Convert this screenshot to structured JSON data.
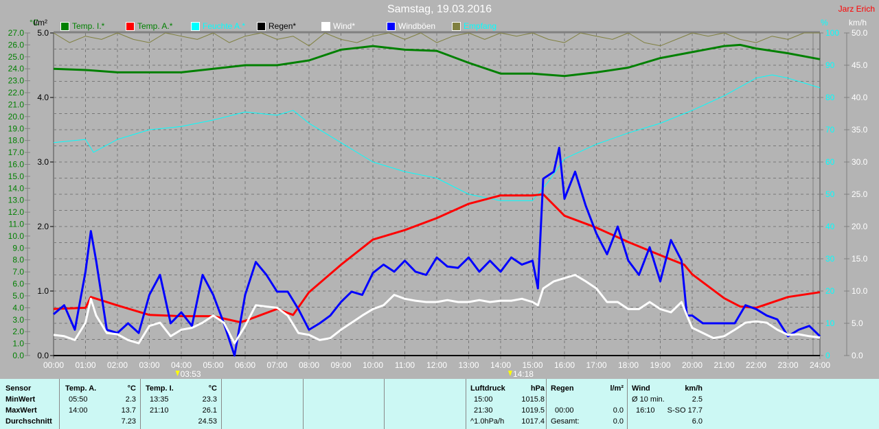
{
  "title": "Samstag, 19.03.2016",
  "author": "Jarz Erich",
  "legend": [
    {
      "label": "Temp. I.*",
      "color": "#008000",
      "text_color": "#008000"
    },
    {
      "label": "Temp. A.*",
      "color": "#ff0000",
      "text_color": "#008000"
    },
    {
      "label": "Feuchte A.*",
      "color": "#00ffff",
      "text_color": "#00ffff"
    },
    {
      "label": "Regen*",
      "color": "#000000",
      "text_color": "#000000"
    },
    {
      "label": "Wind*",
      "color": "#ffffff",
      "text_color": "#ffffff"
    },
    {
      "label": "Windböen",
      "color": "#0000ff",
      "text_color": "#ffffff"
    },
    {
      "label": "Empfang",
      "color": "#808040",
      "text_color": "#00ffff"
    }
  ],
  "axes_units": {
    "temp": "°C",
    "rain": "l/m²",
    "humidity": "%",
    "wind": "km/h"
  },
  "markers": [
    {
      "icon": "moonset-icon",
      "time": "03:53"
    },
    {
      "icon": "moonrise-icon",
      "time": "14:18"
    }
  ],
  "chart_data": {
    "type": "line",
    "grid": true,
    "legend_placement": "top",
    "x_ticks": [
      "00:00",
      "01:00",
      "02:00",
      "03:00",
      "04:00",
      "05:00",
      "06:00",
      "07:00",
      "08:00",
      "09:00",
      "10:00",
      "11:00",
      "12:00",
      "13:00",
      "14:00",
      "15:00",
      "16:00",
      "17:00",
      "18:00",
      "19:00",
      "20:00",
      "21:00",
      "22:00",
      "23:00",
      "24:00"
    ],
    "x_range": [
      "00:00",
      "24:00"
    ],
    "y_axes": {
      "temp": {
        "range": [
          0,
          27
        ],
        "step": 1,
        "color": "#008000"
      },
      "rain": {
        "range": [
          0,
          5
        ],
        "step": 1,
        "color": "#000000"
      },
      "humidity": {
        "range": [
          0,
          100
        ],
        "step": 10,
        "color": "#00ffff"
      },
      "wind": {
        "range": [
          0,
          50
        ],
        "step": 5,
        "color": "#ffffff"
      }
    },
    "series": [
      {
        "name": "Temp. I.*",
        "axis": "temp",
        "color": "#008000",
        "x": [
          "00:00",
          "01:00",
          "02:00",
          "03:00",
          "04:00",
          "05:00",
          "06:00",
          "07:00",
          "08:00",
          "09:00",
          "10:00",
          "11:00",
          "12:00",
          "13:00",
          "14:00",
          "15:00",
          "16:00",
          "17:00",
          "18:00",
          "19:00",
          "20:00",
          "21:00",
          "21:30",
          "22:00",
          "23:00",
          "24:00"
        ],
        "y": [
          24.0,
          23.9,
          23.7,
          23.7,
          23.7,
          24.0,
          24.3,
          24.3,
          24.7,
          25.6,
          25.9,
          25.6,
          25.5,
          24.5,
          23.6,
          23.6,
          23.4,
          23.7,
          24.1,
          24.9,
          25.4,
          25.9,
          26.0,
          25.7,
          25.3,
          24.8
        ]
      },
      {
        "name": "Temp. A.*",
        "axis": "temp",
        "color": "#ff0000",
        "x": [
          "00:00",
          "01:00",
          "01:10",
          "02:00",
          "03:00",
          "04:00",
          "05:00",
          "05:50",
          "06:00",
          "07:00",
          "07:30",
          "08:00",
          "09:00",
          "10:00",
          "11:00",
          "12:00",
          "13:00",
          "14:00",
          "15:00",
          "15:20",
          "16:00",
          "17:00",
          "18:00",
          "19:00",
          "19:45",
          "20:00",
          "21:00",
          "21:30",
          "22:00",
          "23:00",
          "24:00"
        ],
        "y": [
          3.9,
          4.0,
          4.9,
          4.2,
          3.4,
          3.3,
          3.3,
          2.8,
          2.9,
          3.9,
          3.4,
          5.3,
          7.6,
          9.7,
          10.5,
          11.5,
          12.7,
          13.4,
          13.4,
          13.5,
          11.7,
          10.7,
          9.5,
          8.4,
          7.6,
          6.8,
          4.8,
          4.1,
          4.0,
          4.9,
          5.3
        ]
      },
      {
        "name": "Feuchte A.*",
        "axis": "humidity",
        "color": "#00ffff",
        "x": [
          "00:00",
          "01:00",
          "01:15",
          "02:00",
          "03:00",
          "04:00",
          "05:00",
          "06:00",
          "07:00",
          "07:30",
          "08:00",
          "09:00",
          "10:00",
          "11:00",
          "12:00",
          "13:00",
          "14:00",
          "15:00",
          "15:30",
          "16:00",
          "17:00",
          "18:00",
          "19:00",
          "19:45",
          "20:00",
          "21:00",
          "22:00",
          "22:30",
          "23:00",
          "24:00"
        ],
        "y": [
          66,
          67,
          63,
          67,
          70,
          71,
          73,
          75.5,
          74.5,
          76,
          72,
          66,
          60,
          57,
          55,
          50,
          48,
          48,
          54,
          61,
          65.5,
          69,
          72,
          75,
          76,
          80.5,
          86,
          87,
          86,
          83
        ]
      },
      {
        "name": "Regen*",
        "axis": "rain",
        "color": "#000000",
        "x": [
          "00:00",
          "24:00"
        ],
        "y": [
          0,
          0
        ]
      },
      {
        "name": "Wind*",
        "axis": "wind",
        "color": "#ffffff",
        "x": [
          "00:00",
          "00:20",
          "00:40",
          "01:00",
          "01:10",
          "01:20",
          "01:40",
          "02:00",
          "02:20",
          "02:40",
          "03:00",
          "03:20",
          "03:40",
          "04:00",
          "04:20",
          "04:40",
          "05:00",
          "05:20",
          "05:40",
          "06:00",
          "06:20",
          "06:40",
          "07:00",
          "07:20",
          "07:40",
          "08:00",
          "08:20",
          "08:40",
          "09:00",
          "09:20",
          "09:40",
          "10:00",
          "10:20",
          "10:40",
          "11:00",
          "11:20",
          "11:40",
          "12:00",
          "12:20",
          "12:40",
          "13:00",
          "13:20",
          "13:40",
          "14:00",
          "14:20",
          "14:40",
          "15:00",
          "15:10",
          "15:20",
          "15:40",
          "16:00",
          "16:20",
          "16:40",
          "17:00",
          "17:20",
          "17:40",
          "18:00",
          "18:20",
          "18:40",
          "19:00",
          "19:20",
          "19:40",
          "19:50",
          "20:00",
          "20:20",
          "20:40",
          "21:00",
          "21:20",
          "21:40",
          "22:00",
          "22:20",
          "22:40",
          "23:00",
          "23:20",
          "23:40",
          "24:00"
        ],
        "y": [
          3.2,
          3.0,
          2.4,
          5.1,
          8.8,
          6.2,
          3.5,
          3.3,
          2.4,
          1.9,
          4.6,
          5.1,
          3.0,
          4.0,
          4.3,
          5.1,
          6.2,
          5.1,
          1.9,
          4.6,
          7.8,
          7.6,
          7.4,
          6.2,
          3.5,
          3.2,
          2.4,
          2.7,
          4.0,
          5.1,
          6.2,
          7.2,
          7.8,
          9.4,
          8.8,
          8.5,
          8.3,
          8.3,
          8.6,
          8.3,
          8.3,
          8.6,
          8.3,
          8.5,
          8.5,
          8.8,
          8.3,
          7.8,
          10.4,
          11.5,
          12.0,
          12.5,
          11.5,
          10.4,
          8.3,
          8.3,
          7.2,
          7.2,
          8.3,
          7.2,
          6.7,
          8.3,
          6.2,
          4.3,
          3.5,
          2.7,
          3.0,
          4.0,
          5.1,
          5.3,
          5.1,
          4.0,
          3.2,
          3.3,
          3.0,
          2.8
        ]
      },
      {
        "name": "Windböen",
        "axis": "wind",
        "color": "#0000ff",
        "x": [
          "00:00",
          "00:20",
          "00:40",
          "01:00",
          "01:10",
          "01:20",
          "01:40",
          "02:00",
          "02:20",
          "02:40",
          "03:00",
          "03:20",
          "03:40",
          "04:00",
          "04:20",
          "04:40",
          "05:00",
          "05:20",
          "05:40",
          "06:00",
          "06:20",
          "06:40",
          "07:00",
          "07:20",
          "07:40",
          "08:00",
          "08:20",
          "08:40",
          "09:00",
          "09:20",
          "09:40",
          "10:00",
          "10:20",
          "10:40",
          "11:00",
          "11:20",
          "11:40",
          "12:00",
          "12:20",
          "12:40",
          "13:00",
          "13:20",
          "13:40",
          "14:00",
          "14:20",
          "14:40",
          "15:00",
          "15:10",
          "15:20",
          "15:40",
          "15:50",
          "16:00",
          "16:20",
          "16:40",
          "17:00",
          "17:20",
          "17:40",
          "18:00",
          "18:20",
          "18:40",
          "19:00",
          "19:20",
          "19:40",
          "19:50",
          "20:00",
          "20:20",
          "20:40",
          "21:00",
          "21:20",
          "21:40",
          "22:00",
          "22:20",
          "22:40",
          "23:00",
          "23:20",
          "23:40",
          "24:00"
        ],
        "y": [
          6.4,
          7.8,
          4.0,
          13.0,
          19.3,
          14.7,
          4.0,
          3.5,
          5.0,
          3.5,
          9.4,
          12.5,
          5.0,
          6.7,
          4.6,
          12.5,
          9.4,
          5.0,
          0.0,
          9.4,
          14.5,
          12.5,
          9.9,
          9.9,
          7.2,
          4.0,
          5.0,
          6.2,
          8.3,
          9.9,
          9.4,
          12.8,
          14.1,
          13.0,
          14.7,
          13.0,
          12.5,
          15.2,
          13.8,
          13.6,
          15.2,
          13.0,
          14.7,
          13.0,
          15.2,
          14.1,
          14.7,
          10.4,
          27.4,
          28.5,
          32.2,
          24.3,
          28.5,
          23.2,
          18.9,
          15.7,
          20.0,
          14.7,
          12.5,
          16.8,
          11.5,
          17.9,
          14.7,
          6.2,
          6.2,
          5.0,
          5.0,
          5.0,
          5.0,
          7.8,
          7.2,
          6.2,
          5.6,
          3.0,
          4.0,
          4.6,
          3.0
        ]
      },
      {
        "name": "Empfang",
        "axis": "humidity",
        "color": "#808040",
        "x": [
          "00:00",
          "00:30",
          "01:00",
          "01:30",
          "02:00",
          "02:30",
          "03:00",
          "03:30",
          "04:00",
          "04:30",
          "05:00",
          "05:30",
          "06:00",
          "06:30",
          "07:00",
          "07:30",
          "08:00",
          "08:30",
          "09:00",
          "09:30",
          "10:00",
          "10:30",
          "11:00",
          "11:30",
          "12:00",
          "12:30",
          "13:00",
          "13:30",
          "14:00",
          "14:30",
          "15:00",
          "15:30",
          "16:00",
          "16:30",
          "17:00",
          "17:30",
          "18:00",
          "18:30",
          "19:00",
          "19:30",
          "20:00",
          "20:30",
          "21:00",
          "21:30",
          "22:00",
          "22:30",
          "23:00",
          "23:30",
          "24:00"
        ],
        "y": [
          100,
          97,
          99,
          98,
          100,
          98,
          97,
          100,
          99,
          98,
          100,
          97,
          99,
          100,
          98,
          99,
          96,
          100,
          98,
          97,
          99,
          100,
          98,
          100,
          97,
          99,
          100,
          98,
          100,
          99,
          100,
          98,
          97,
          100,
          99,
          98,
          100,
          97,
          96,
          98,
          100,
          99,
          100,
          98,
          97,
          99,
          98,
          100,
          100
        ]
      }
    ]
  },
  "stats": {
    "sensor_label": "Sensor",
    "row_labels": [
      "MinWert",
      "MaxWert",
      "Durchschnitt"
    ],
    "temp_a": {
      "header": "Temp. A.",
      "unit": "°C",
      "min_time": "05:50",
      "min": "2.3",
      "max_time": "14:00",
      "max": "13.7",
      "avg": "7.23"
    },
    "temp_i": {
      "header": "Temp. I.",
      "unit": "°C",
      "min_time": "13:35",
      "min": "23.3",
      "max_time": "21:10",
      "max": "26.1",
      "avg": "24.53"
    },
    "pressure": {
      "header": "Luftdruck",
      "unit": "hPa",
      "r1_label": "15:00",
      "r1": "1015.8",
      "r2_label": "21:30",
      "r2": "1019.5",
      "r3_label": "^1.0hPa/h",
      "r3": "1017.4"
    },
    "rain": {
      "header": "Regen",
      "unit": "l/m²",
      "r2_label": "00:00",
      "r2": "0.0",
      "r3_label": "Gesamt:",
      "r3": "0.0"
    },
    "wind": {
      "header": "Wind",
      "unit": "km/h",
      "r1_label": "Ø 10 min.",
      "r1": "2.5",
      "r2_label": "16:10",
      "r2": "S-SO 17.7",
      "r3": "6.0"
    }
  }
}
